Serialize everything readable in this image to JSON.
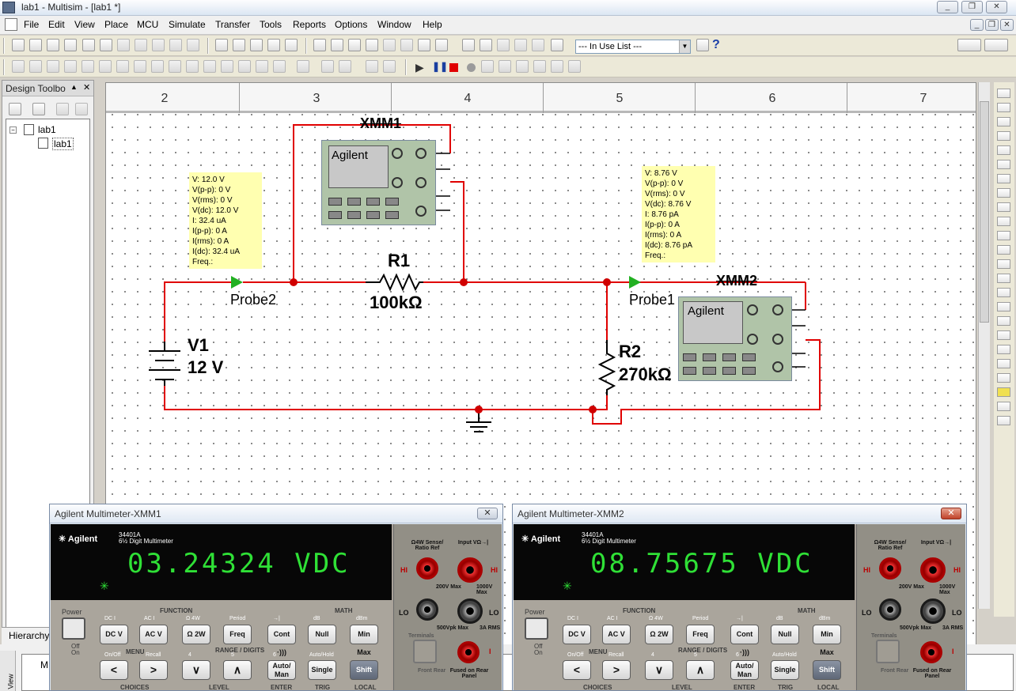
{
  "window": {
    "title": "lab1 - Multisim - [lab1 *]",
    "controls": [
      "_",
      "❐",
      "✕"
    ],
    "doc_controls": [
      "_",
      "❐",
      "✕"
    ]
  },
  "menu": [
    "File",
    "Edit",
    "View",
    "Place",
    "MCU",
    "Simulate",
    "Transfer",
    "Tools",
    "Reports",
    "Options",
    "Window",
    "Help"
  ],
  "toolbar": {
    "in_use_list": "--- In Use List ---"
  },
  "design_toolbox": {
    "title": "Design Toolbo",
    "pin": "▲",
    "close": "✕",
    "root": "lab1",
    "child": "lab1",
    "hierarchy_tab": "Hierarchy"
  },
  "ruler": {
    "columns": [
      "2",
      "3",
      "4",
      "5",
      "6",
      "7"
    ]
  },
  "schematic": {
    "V1": {
      "name": "V1",
      "value": "12 V"
    },
    "R1": {
      "name": "R1",
      "value": "100kΩ"
    },
    "R2": {
      "name": "R2",
      "value": "270kΩ"
    },
    "XMM1": {
      "name": "XMM1",
      "brand": "Agilent"
    },
    "XMM2": {
      "name": "XMM2",
      "brand": "Agilent"
    },
    "probe2": {
      "name": "Probe2",
      "readings": [
        "V: 12.0 V",
        "V(p-p): 0 V",
        "V(rms): 0 V",
        "V(dc): 12.0 V",
        "I: 32.4 uA",
        "I(p-p): 0 A",
        "I(rms): 0 A",
        "I(dc): 32.4 uA",
        "Freq.:"
      ]
    },
    "probe1": {
      "name": "Probe1",
      "readings": [
        "V: 8.76 V",
        "V(p-p): 0 V",
        "V(rms): 0 V",
        "V(dc): 8.76 V",
        "I: 8.76 pA",
        "I(p-p): 0 A",
        "I(rms): 0 A",
        "I(dc): 8.76 pA",
        "Freq.:"
      ]
    }
  },
  "mm1": {
    "title": "Agilent Multimeter-XMM1",
    "reading": "03.24324 VDC"
  },
  "mm2": {
    "title": "Agilent Multimeter-XMM2",
    "reading": "08.75675 VDC"
  },
  "meter_common": {
    "brand": "Agilent",
    "model": "34401A",
    "model_sub": "6½ Digit Multimeter",
    "asterisk": "✳",
    "power": "Power",
    "off": "Off",
    "on": "On",
    "function": "FUNCTION",
    "math": "MATH",
    "menu": "MENU",
    "range": "RANGE / DIGITS",
    "top_labels": [
      "DC I",
      "AC I",
      "Ω 4W",
      "Period",
      "→|",
      "dB",
      "dBm"
    ],
    "keys_row1": [
      "DC V",
      "AC V",
      "Ω 2W",
      "Freq",
      "Cont ·)))",
      "Null",
      "Min Max"
    ],
    "mid_labels": [
      "On/Off",
      "Recall",
      "4",
      "5",
      "6",
      "Auto/Hold"
    ],
    "keys_row2": [
      "<",
      ">",
      "∨",
      "∧",
      "Auto/ Man",
      "Single",
      "Shift"
    ],
    "bottom_labels": [
      "CHOICES",
      "LEVEL",
      "ENTER",
      "TRIG",
      "LOCAL"
    ],
    "term": {
      "sense": "Ω4W Sense/ Ratio Ref",
      "input": "Input VΩ→|",
      "hi": "HI",
      "lo": "LO",
      "v200": "200V Max",
      "v1000": "1000V Max",
      "v500": "500Vpk Max",
      "a3": "3A RMS",
      "i": "I",
      "terminals": "Terminals",
      "front_rear": "Front Rear",
      "fused": "Fused on Rear Panel"
    }
  },
  "status": {
    "text": "M",
    "side_tab": "View"
  },
  "colors": {
    "wire": "#e00000",
    "node": "#d00000",
    "dmm_body": "#b0c4a8",
    "probe": "#22b022",
    "probe_box": "#ffffb0",
    "display_text": "#2fe036"
  }
}
